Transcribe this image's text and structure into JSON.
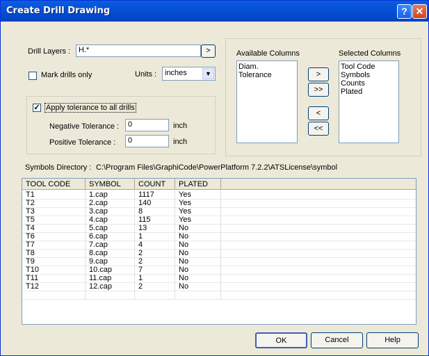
{
  "window": {
    "title": "Create Drill Drawing",
    "help": "?",
    "close": "✕"
  },
  "drill": {
    "label": "Drill Layers :",
    "value": "H.*",
    "browse": ">",
    "mark_only": "Mark drills only",
    "units_label": "Units :",
    "units_value": "inches"
  },
  "tolerance": {
    "apply_label": "Apply tolerance to all drills",
    "neg_label": "Negative Tolerance :",
    "neg_value": "0",
    "pos_label": "Positive Tolerance :",
    "pos_value": "0",
    "unit": "inch"
  },
  "columns": {
    "available_label": "Available Columns",
    "selected_label": "Selected Columns",
    "available": [
      "Diam.",
      "Tolerance"
    ],
    "selected": [
      "Tool Code",
      "Symbols",
      "Counts",
      "Plated"
    ],
    "add": ">",
    "add_all": ">>",
    "remove": "<",
    "remove_all": "<<"
  },
  "symbols": {
    "label": "Symbols Directory :",
    "path": "C:\\Program Files\\GraphiCode\\PowerPlatform 7.2.2\\ATSLicense\\symbol"
  },
  "table": {
    "headers": [
      "TOOL CODE",
      "SYMBOL",
      "COUNT",
      "PLATED"
    ],
    "rows": [
      [
        "T1",
        "1.cap",
        "1117",
        "Yes"
      ],
      [
        "T2",
        "2.cap",
        "140",
        "Yes"
      ],
      [
        "T3",
        "3.cap",
        "8",
        "Yes"
      ],
      [
        "T5",
        "4.cap",
        "115",
        "Yes"
      ],
      [
        "T4",
        "5.cap",
        "13",
        "No"
      ],
      [
        "T6",
        "6.cap",
        "1",
        "No"
      ],
      [
        "T7",
        "7.cap",
        "4",
        "No"
      ],
      [
        "T8",
        "8.cap",
        "2",
        "No"
      ],
      [
        "T9",
        "9.cap",
        "2",
        "No"
      ],
      [
        "T10",
        "10.cap",
        "7",
        "No"
      ],
      [
        "T11",
        "11.cap",
        "1",
        "No"
      ],
      [
        "T12",
        "12.cap",
        "2",
        "No"
      ]
    ]
  },
  "buttons": {
    "ok": "OK",
    "cancel": "Cancel",
    "help": "Help"
  }
}
